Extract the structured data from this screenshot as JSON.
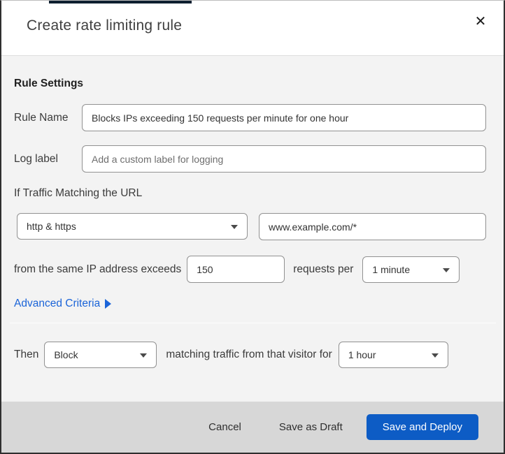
{
  "colors": {
    "accent_blue": "#0d5cc5",
    "link_blue": "#1b64d8",
    "topbar_navy": "#0e1f30"
  },
  "dialog": {
    "title": "Create rate limiting rule",
    "close_glyph": "✕"
  },
  "rule_settings": {
    "heading": "Rule Settings",
    "rule_name_label": "Rule Name",
    "rule_name_value": "Blocks IPs exceeding 150 requests per minute for one hour",
    "log_label_label": "Log label",
    "log_label_placeholder": "Add a custom label for logging"
  },
  "match": {
    "heading": "If Traffic Matching the URL",
    "scheme_selected": "http & https",
    "url_value": "www.example.com/*",
    "threshold_prefix": "from the same IP address exceeds",
    "threshold_value": "150",
    "threshold_unit_label": "requests per",
    "period_selected": "1 minute",
    "advanced_link": "Advanced Criteria"
  },
  "action": {
    "then_label": "Then",
    "action_selected": "Block",
    "middle_label": "matching traffic from that visitor for",
    "duration_selected": "1 hour"
  },
  "footer": {
    "cancel_label": "Cancel",
    "save_draft_label": "Save as Draft",
    "save_deploy_label": "Save and Deploy"
  }
}
